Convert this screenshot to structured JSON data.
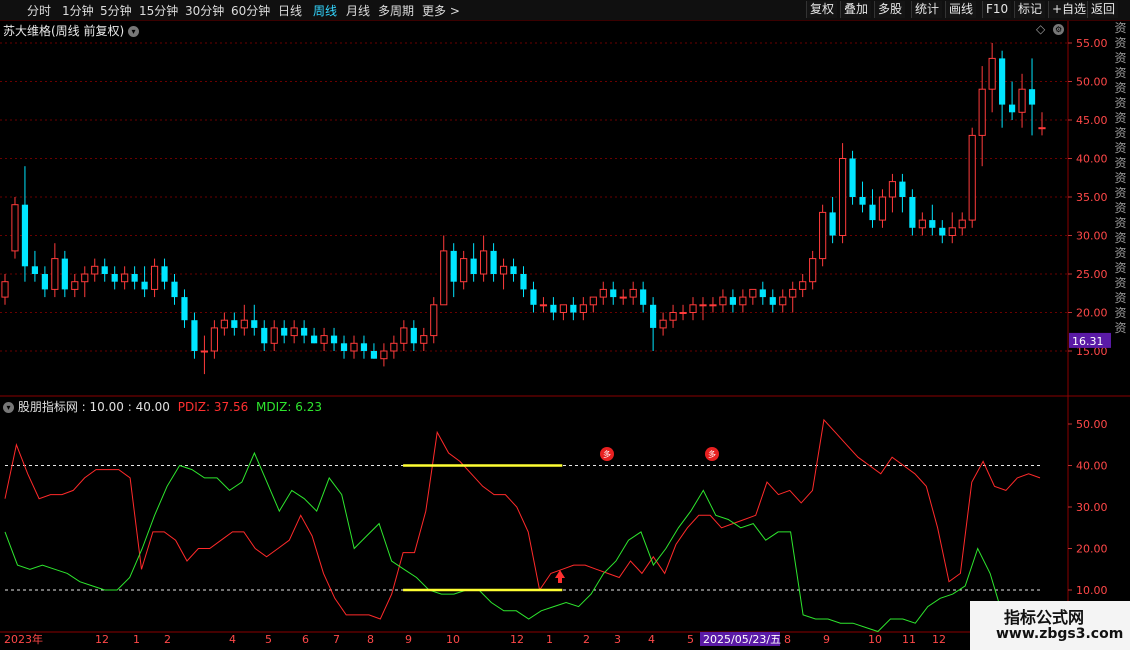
{
  "toolbar": {
    "periods": [
      "分时",
      "1分钟",
      "5分钟",
      "15分钟",
      "30分钟",
      "60分钟",
      "日线",
      "周线",
      "月线",
      "多周期",
      "更多 >"
    ],
    "active_period": "周线",
    "right_buttons": [
      "复权",
      "叠加",
      "多股",
      "统计",
      "画线",
      "F10",
      "标记",
      "+自选",
      "返回"
    ]
  },
  "main_chart": {
    "title": "苏大维格(周线 前复权)",
    "price_ticks": [
      "55.00",
      "50.00",
      "45.00",
      "40.00",
      "35.00",
      "30.00",
      "25.00",
      "20.00",
      "15.00"
    ],
    "current_price": "16.31",
    "colors": {
      "up": "#ff3b3b",
      "down": "#00e5ff",
      "grid": "#6a0000",
      "price_badge": "#5a1aa6"
    }
  },
  "indicator": {
    "name": "股朋指标网",
    "params": "10.00 : 40.00",
    "pdiz_label": "PDIZ: 37.56",
    "mdiz_label": "MDIZ: 6.23",
    "ticks": [
      "50.00",
      "40.00",
      "30.00",
      "20.00",
      "10.00"
    ],
    "colors": {
      "pdiz": "#ff2a2a",
      "mdiz": "#2ee62e",
      "highlight": "#ffff33"
    },
    "marker_glyph": "多"
  },
  "time_axis": {
    "labels": [
      "2023年",
      "12",
      "1",
      "2",
      "4",
      "5",
      "6",
      "7",
      "8",
      "9",
      "10",
      "12",
      "1",
      "2",
      "3",
      "4",
      "5",
      "8",
      "9",
      "10",
      "11",
      "12"
    ],
    "cursor_date": "2025/05/23/五"
  },
  "side_strip": "资资资资资资资资资资资资资资资资资资资资资",
  "watermark": {
    "title": "指标公式网",
    "url": "www.zbgs3.com"
  },
  "chart_data": [
    {
      "type": "candlestick",
      "title": "苏大维格(周线 前复权)",
      "ylim": [
        10,
        56
      ],
      "ohlc": [
        [
          22,
          25,
          21,
          24
        ],
        [
          28,
          35,
          27,
          34
        ],
        [
          34,
          39,
          24,
          26
        ],
        [
          26,
          28,
          24,
          25
        ],
        [
          25,
          26,
          22,
          23
        ],
        [
          23,
          29,
          22,
          27
        ],
        [
          27,
          28,
          22,
          23
        ],
        [
          23,
          25,
          22,
          24
        ],
        [
          24,
          26,
          22,
          25
        ],
        [
          25,
          27,
          24,
          26
        ],
        [
          26,
          27,
          24,
          25
        ],
        [
          25,
          26,
          23,
          24
        ],
        [
          24,
          26,
          23,
          25
        ],
        [
          25,
          26,
          23,
          24
        ],
        [
          24,
          26,
          22,
          23
        ],
        [
          23,
          27,
          22,
          26
        ],
        [
          26,
          27,
          23,
          24
        ],
        [
          24,
          25,
          21,
          22
        ],
        [
          22,
          23,
          18,
          19
        ],
        [
          19,
          20,
          14,
          15
        ],
        [
          15,
          17,
          12,
          15
        ],
        [
          15,
          19,
          14,
          18
        ],
        [
          18,
          20,
          17,
          19
        ],
        [
          19,
          20,
          17,
          18
        ],
        [
          18,
          21,
          17,
          19
        ],
        [
          19,
          21,
          17,
          18
        ],
        [
          18,
          19,
          15,
          16
        ],
        [
          16,
          19,
          15,
          18
        ],
        [
          18,
          19,
          16,
          17
        ],
        [
          17,
          19,
          16,
          18
        ],
        [
          18,
          19,
          16,
          17
        ],
        [
          17,
          18,
          16,
          16
        ],
        [
          16,
          18,
          15,
          17
        ],
        [
          17,
          18,
          15,
          16
        ],
        [
          16,
          17,
          14,
          15
        ],
        [
          15,
          17,
          14,
          16
        ],
        [
          16,
          17,
          14,
          15
        ],
        [
          15,
          16,
          14,
          14
        ],
        [
          14,
          16,
          13,
          15
        ],
        [
          15,
          17,
          14,
          16
        ],
        [
          16,
          19,
          15,
          18
        ],
        [
          18,
          19,
          15,
          16
        ],
        [
          16,
          18,
          15,
          17
        ],
        [
          17,
          22,
          16,
          21
        ],
        [
          21,
          30,
          21,
          28
        ],
        [
          28,
          29,
          22,
          24
        ],
        [
          24,
          28,
          23,
          27
        ],
        [
          27,
          29,
          24,
          25
        ],
        [
          25,
          30,
          24,
          28
        ],
        [
          28,
          29,
          24,
          25
        ],
        [
          25,
          27,
          23,
          26
        ],
        [
          26,
          27,
          24,
          25
        ],
        [
          25,
          26,
          22,
          23
        ],
        [
          23,
          24,
          20,
          21
        ],
        [
          21,
          22,
          20,
          21
        ],
        [
          21,
          22,
          19,
          20
        ],
        [
          20,
          21,
          19,
          21
        ],
        [
          21,
          22,
          19,
          20
        ],
        [
          20,
          22,
          19,
          21
        ],
        [
          21,
          22,
          20,
          22
        ],
        [
          22,
          24,
          21,
          23
        ],
        [
          23,
          24,
          21,
          22
        ],
        [
          22,
          23,
          21,
          22
        ],
        [
          22,
          24,
          21,
          23
        ],
        [
          23,
          24,
          20,
          21
        ],
        [
          21,
          22,
          15,
          18
        ],
        [
          18,
          20,
          17,
          19
        ],
        [
          19,
          21,
          18,
          20
        ],
        [
          20,
          21,
          19,
          20
        ],
        [
          20,
          22,
          19,
          21
        ],
        [
          21,
          22,
          19,
          21
        ],
        [
          21,
          22,
          20,
          21
        ],
        [
          21,
          23,
          20,
          22
        ],
        [
          22,
          23,
          20,
          21
        ],
        [
          21,
          23,
          20,
          22
        ],
        [
          22,
          23,
          21,
          23
        ],
        [
          23,
          24,
          21,
          22
        ],
        [
          22,
          23,
          20,
          21
        ],
        [
          21,
          23,
          20,
          22
        ],
        [
          22,
          24,
          20,
          23
        ],
        [
          23,
          25,
          22,
          24
        ],
        [
          24,
          28,
          23,
          27
        ],
        [
          27,
          34,
          26,
          33
        ],
        [
          33,
          35,
          29,
          30
        ],
        [
          30,
          42,
          29,
          40
        ],
        [
          40,
          41,
          34,
          35
        ],
        [
          35,
          37,
          33,
          34
        ],
        [
          34,
          36,
          31,
          32
        ],
        [
          32,
          36,
          31,
          35
        ],
        [
          35,
          38,
          33,
          37
        ],
        [
          37,
          38,
          33,
          35
        ],
        [
          35,
          36,
          30,
          31
        ],
        [
          31,
          33,
          30,
          32
        ],
        [
          32,
          34,
          30,
          31
        ],
        [
          31,
          32,
          29,
          30
        ],
        [
          30,
          33,
          29,
          31
        ],
        [
          31,
          33,
          30,
          32
        ],
        [
          32,
          44,
          31,
          43
        ],
        [
          43,
          52,
          39,
          49
        ],
        [
          49,
          55,
          46,
          53
        ],
        [
          53,
          54,
          44,
          47
        ],
        [
          47,
          50,
          45,
          46
        ],
        [
          46,
          51,
          44,
          49
        ],
        [
          49,
          53,
          43,
          47
        ],
        [
          44,
          46,
          43,
          44
        ]
      ]
    },
    {
      "type": "line",
      "title": "股朋指标网",
      "ylim": [
        0,
        55
      ],
      "reference_lines": [
        10,
        40
      ],
      "highlight_segments": [
        [
          35,
          49,
          40
        ],
        [
          35,
          49,
          10
        ]
      ],
      "series": [
        {
          "name": "PDIZ",
          "values": [
            32,
            45,
            38,
            32,
            33,
            33,
            34,
            37,
            39,
            39,
            39,
            37,
            15,
            24,
            24,
            22,
            17,
            20,
            20,
            22,
            24,
            24,
            20,
            18,
            20,
            22,
            28,
            23,
            14,
            8,
            4,
            4,
            4,
            3,
            9,
            19,
            19,
            29,
            48,
            43,
            41,
            38,
            35,
            33,
            33,
            30,
            24,
            10,
            14,
            15,
            16,
            16,
            15,
            14,
            13,
            17,
            14,
            18,
            14,
            21,
            25,
            28,
            28,
            25,
            26,
            27,
            28,
            36,
            33,
            34,
            31,
            34,
            51,
            48,
            45,
            42,
            40,
            38,
            42,
            40,
            38,
            35,
            25,
            12,
            14,
            36,
            41,
            35,
            34,
            37,
            38,
            37
          ]
        },
        {
          "name": "MDIZ",
          "values": [
            24,
            16,
            15,
            16,
            15,
            14,
            12,
            11,
            10,
            10,
            13,
            20,
            28,
            35,
            40,
            39,
            37,
            37,
            34,
            36,
            43,
            36,
            29,
            34,
            32,
            29,
            37,
            33,
            20,
            23,
            26,
            17,
            15,
            13,
            10,
            9,
            9,
            10,
            10,
            7,
            5,
            5,
            3,
            5,
            6,
            7,
            6,
            9,
            14,
            17,
            22,
            24,
            16,
            20,
            25,
            29,
            34,
            28,
            27,
            25,
            26,
            22,
            24,
            24,
            4,
            3,
            3,
            2,
            2,
            1,
            0,
            3,
            3,
            2,
            6,
            8,
            9,
            11,
            20,
            14,
            4,
            2,
            3,
            2
          ]
        }
      ]
    }
  ]
}
